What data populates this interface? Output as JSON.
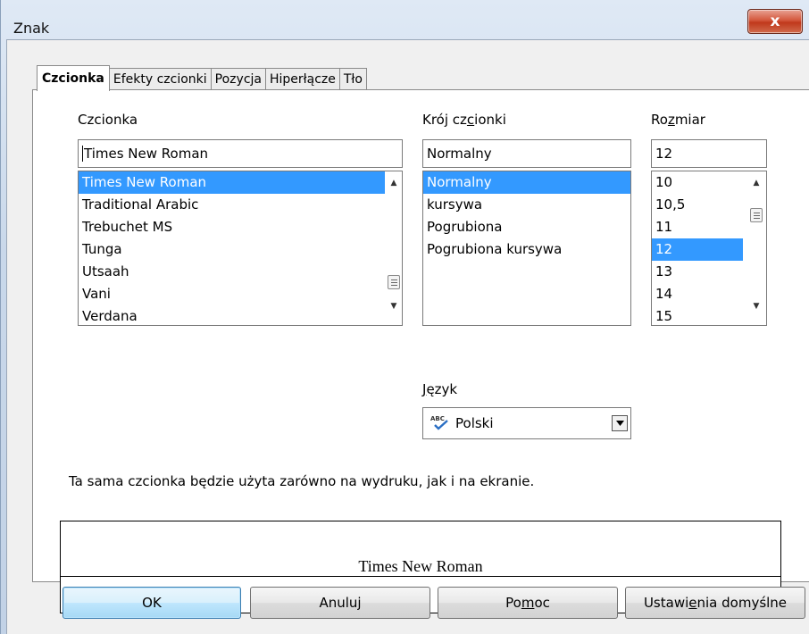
{
  "window": {
    "title": "Znak",
    "close_glyph": "x"
  },
  "tabs": [
    {
      "label": "Czcionka",
      "active": true
    },
    {
      "label": "Efekty czcionki",
      "active": false
    },
    {
      "label": "Pozycja",
      "active": false
    },
    {
      "label": "Hiperłącze",
      "active": false
    },
    {
      "label": "Tło",
      "active": false
    }
  ],
  "font": {
    "label": "Czcionka",
    "value": "Times New Roman",
    "items": [
      "Times New Roman",
      "Traditional Arabic",
      "Trebuchet MS",
      "Tunga",
      "Utsaah",
      "Vani",
      "Verdana"
    ],
    "selected_index": 0
  },
  "style": {
    "label": "Krój czcionki",
    "value": "Normalny",
    "items": [
      "Normalny",
      "kursywa",
      "Pogrubiona",
      "Pogrubiona kursywa"
    ],
    "selected_index": 0
  },
  "size": {
    "label": "Rozmiar",
    "value": "12",
    "items": [
      "10",
      "10,5",
      "11",
      "12",
      "13",
      "14",
      "15"
    ],
    "selected_index": 3
  },
  "language": {
    "label": "Język",
    "value": "Polski",
    "icon": "spellcheck-icon",
    "icon_text": "ABC"
  },
  "note": "Ta sama czcionka będzie użyta zarówno na wydruku, jak i na ekranie.",
  "preview": {
    "text": "Times New Roman"
  },
  "buttons": {
    "ok": "OK",
    "cancel": "Anuluj",
    "help": "Pomoc",
    "defaults": "Ustawienia domyślne"
  },
  "colors": {
    "selection": "#3399ff",
    "close": "#c7442a"
  }
}
